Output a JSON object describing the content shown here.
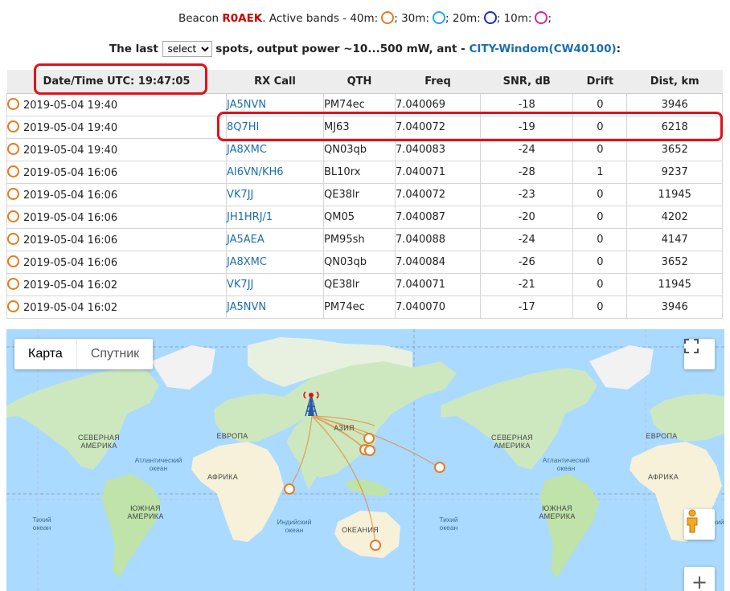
{
  "header": {
    "beacon_prefix": "Beacon",
    "beacon_call": "R0AEK",
    "active_text": ". Active bands -",
    "bands": [
      {
        "label": "40m:",
        "color": "#e87a1e"
      },
      {
        "label": "30m:",
        "color": "#22a7e8"
      },
      {
        "label": "20m:",
        "color": "#1f2fa8"
      },
      {
        "label": "10m:",
        "color": "#e0258a"
      }
    ],
    "sep": ";",
    "last_text": "The last",
    "select_value": "select",
    "spots_text": "spots, output power ~10...500 mW, ant -",
    "antenna": "CITY-Windom(CW40100)",
    "antenna_suffix": ":"
  },
  "table": {
    "columns": [
      "Date/Time UTC: 19:47:05",
      "RX Call",
      "QTH",
      "Freq",
      "SNR, dB",
      "Drift",
      "Dist, km"
    ],
    "rows": [
      {
        "dt": "2019-05-04 19:40",
        "rx": "JA5NVN",
        "qth": "PM74ec",
        "freq": "7.040069",
        "snr": "-18",
        "drift": "0",
        "dist": "3946"
      },
      {
        "dt": "2019-05-04 19:40",
        "rx": "8Q7HI",
        "qth": "MJ63",
        "freq": "7.040072",
        "snr": "-19",
        "drift": "0",
        "dist": "6218"
      },
      {
        "dt": "2019-05-04 19:40",
        "rx": "JA8XMC",
        "qth": "QN03qb",
        "freq": "7.040083",
        "snr": "-24",
        "drift": "0",
        "dist": "3652"
      },
      {
        "dt": "2019-05-04 16:06",
        "rx": "AI6VN/KH6",
        "qth": "BL10rx",
        "freq": "7.040071",
        "snr": "-28",
        "drift": "1",
        "dist": "9237"
      },
      {
        "dt": "2019-05-04 16:06",
        "rx": "VK7JJ",
        "qth": "QE38lr",
        "freq": "7.040072",
        "snr": "-23",
        "drift": "0",
        "dist": "11945"
      },
      {
        "dt": "2019-05-04 16:06",
        "rx": "JH1HRJ/1",
        "qth": "QM05",
        "freq": "7.040087",
        "snr": "-20",
        "drift": "0",
        "dist": "4202"
      },
      {
        "dt": "2019-05-04 16:06",
        "rx": "JA5AEA",
        "qth": "PM95sh",
        "freq": "7.040088",
        "snr": "-24",
        "drift": "0",
        "dist": "4147"
      },
      {
        "dt": "2019-05-04 16:06",
        "rx": "JA8XMC",
        "qth": "QN03qb",
        "freq": "7.040084",
        "snr": "-26",
        "drift": "0",
        "dist": "3652"
      },
      {
        "dt": "2019-05-04 16:02",
        "rx": "VK7JJ",
        "qth": "QE38lr",
        "freq": "7.040071",
        "snr": "-21",
        "drift": "0",
        "dist": "11945"
      },
      {
        "dt": "2019-05-04 16:02",
        "rx": "JA5NVN",
        "qth": "PM74ec",
        "freq": "7.040070",
        "snr": "-17",
        "drift": "0",
        "dist": "3946"
      }
    ]
  },
  "map": {
    "tab_map": "Карта",
    "tab_satellite": "Спутник",
    "fullscreen_icon": "fullscreen-icon",
    "pegman_icon": "pegman-icon",
    "zoom_in": "+",
    "labels": {
      "north_america_l": "СЕВЕРНАЯ АМЕРИКА",
      "north_america_r": "СЕВЕРНАЯ АМЕРИКА",
      "europe": "ЕВРОПА",
      "europe_r": "ЕВРОПА",
      "africa": "АФРИКА",
      "africa_r": "АФРИКА",
      "asia": "АЗИЯ",
      "south_america_l": "ЮЖНАЯ АМЕРИКА",
      "south_america_r": "ЮЖНАЯ АМЕРИКА",
      "oceania": "ОКЕАНИЯ",
      "atlantic_l": "Атлантический океан",
      "atlantic_r": "Атлантический океан",
      "pacific_l": "Тихий океан",
      "pacific_r": "Тихий океан",
      "indian_l": "Индийский океан",
      "indian_r": "Индийский океан"
    }
  }
}
